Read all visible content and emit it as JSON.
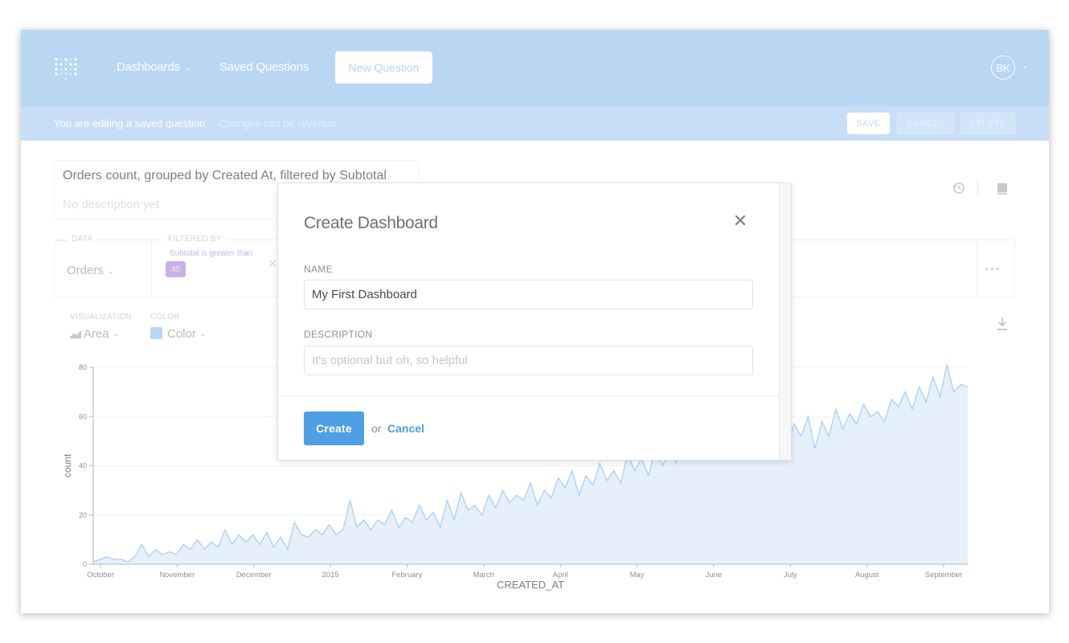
{
  "nav": {
    "dashboards": "Dashboards",
    "saved_questions": "Saved Questions",
    "new_question": "New Question",
    "avatar_initials": "BK"
  },
  "edit_bar": {
    "message": "You are editing a saved question",
    "sub_message": "Changes can be reverted.",
    "save": "SAVE",
    "cancel": "CANCEL",
    "delete": "DELETE"
  },
  "question": {
    "title": "Orders count, grouped by Created At, filtered by Subtotal",
    "description_placeholder": "No description yet"
  },
  "query_bar": {
    "data_label": "DATA",
    "data_value": "Orders",
    "filtered_by_label": "FILTERED BY",
    "filter_text": "Subtotal is greater than",
    "filter_value": "40"
  },
  "viz": {
    "visualization_label": "VISUALIZATION",
    "visualization_value": "Area",
    "color_label": "COLOR",
    "color_value": "Color",
    "color_swatch": "#b7d7f5"
  },
  "modal": {
    "title": "Create Dashboard",
    "name_label": "NAME",
    "name_value": "My First Dashboard",
    "description_label": "DESCRIPTION",
    "description_placeholder": "It's optional but oh, so helpful",
    "create_button": "Create",
    "or_text": "or",
    "cancel_link": "Cancel"
  },
  "colors": {
    "nav_bg": "#b9d6f3",
    "edit_bar_bg": "#c7def6",
    "accent": "#509ee3",
    "filter_purple": "#c8b1e6",
    "series_line": "#a9cff1",
    "series_fill": "#e6f0fb"
  },
  "chart_data": {
    "type": "area",
    "xlabel": "CREATED_AT",
    "ylabel": "count",
    "ylim": [
      0,
      80
    ],
    "y_ticks": [
      "0",
      "20",
      "40",
      "60",
      "80"
    ],
    "x_ticks": [
      "October",
      "November",
      "December",
      "2015",
      "February",
      "March",
      "April",
      "May",
      "June",
      "July",
      "August",
      "September"
    ],
    "series": [
      {
        "values": [
          1,
          2,
          3,
          2,
          2,
          1,
          3,
          8,
          3,
          6,
          4,
          5,
          4,
          8,
          6,
          10,
          6,
          9,
          7,
          14,
          8,
          12,
          9,
          12,
          8,
          13,
          7,
          11,
          6,
          17,
          12,
          11,
          14,
          12,
          16,
          12,
          14,
          26,
          15,
          18,
          14,
          18,
          16,
          22,
          15,
          19,
          17,
          24,
          18,
          21,
          15,
          26,
          18,
          29,
          22,
          24,
          20,
          28,
          23,
          30,
          25,
          28,
          26,
          33,
          24,
          30,
          27,
          35,
          31,
          38,
          28,
          36,
          32,
          41,
          34,
          38,
          33,
          45,
          38,
          43,
          36,
          48,
          40,
          46,
          41,
          52,
          44,
          50,
          45,
          53,
          46,
          56,
          49,
          60,
          47,
          55,
          50,
          58,
          46,
          54,
          49,
          57,
          52,
          60,
          47,
          58,
          52,
          63,
          55,
          61,
          57,
          65,
          60,
          62,
          58,
          67,
          64,
          70,
          63,
          72,
          66,
          76,
          68,
          81,
          70,
          73,
          72
        ]
      }
    ]
  }
}
